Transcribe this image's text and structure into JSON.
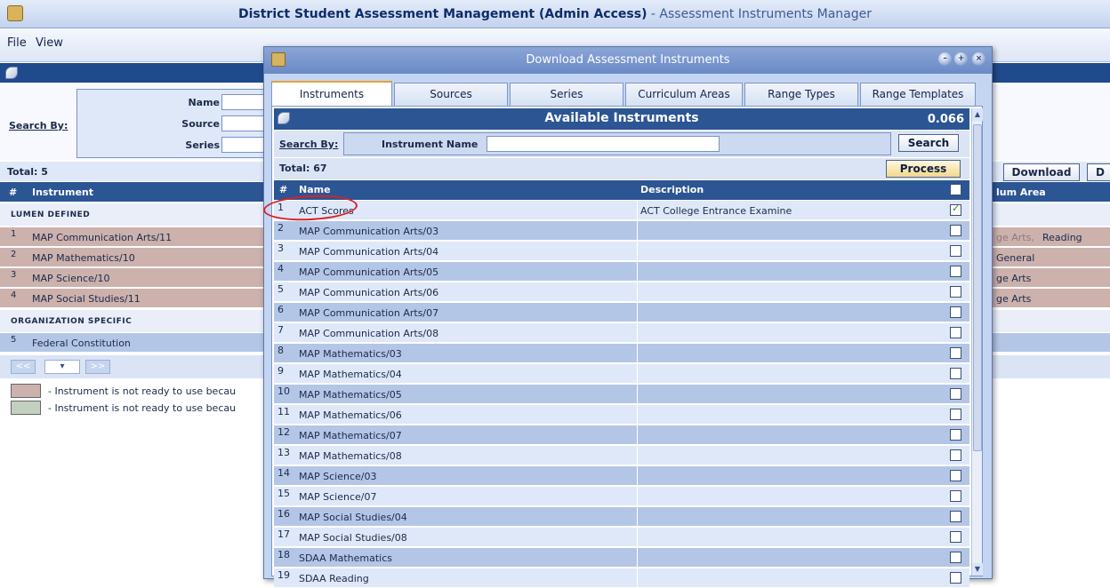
{
  "app": {
    "title_bold": "District Student Assessment Management (Admin Access)",
    "title_sub": " - Assessment Instruments Manager"
  },
  "menu": {
    "file": "File",
    "view": "View"
  },
  "background": {
    "search_by": "Search By:",
    "fields": {
      "name": "Name",
      "source": "Source",
      "series": "Series"
    },
    "total": "Total: 5",
    "col_num": "#",
    "col_instrument": "Instrument",
    "col_area": "lum Area",
    "download_label": "Download",
    "extra_btn_label": "D",
    "group_lumen": "Lumen Defined",
    "group_org": "Organization Specific",
    "rows": [
      {
        "num": "1",
        "name": "MAP Communication Arts/11",
        "area_faded": "ge Arts, ",
        "area": "Reading"
      },
      {
        "num": "2",
        "name": "MAP Mathematics/10",
        "area_faded": "",
        "area": "General"
      },
      {
        "num": "3",
        "name": "MAP Science/10",
        "area_faded": "",
        "area": "ge Arts"
      },
      {
        "num": "4",
        "name": "MAP Social Studies/11",
        "area_faded": "",
        "area": "ge Arts"
      }
    ],
    "org_row": {
      "num": "5",
      "name": "Federal Constitution"
    },
    "pager": {
      "prev": "<<",
      "next": ">>"
    },
    "legend": [
      {
        "color": "#ccb1ad",
        "text": "- Instrument is not ready to use becau"
      },
      {
        "color": "#c3d0c0",
        "text": "- Instrument is not ready to use becau"
      }
    ]
  },
  "dialog": {
    "title": "Download Assessment Instruments",
    "tabs": [
      "Instruments",
      "Sources",
      "Series",
      "Curriculum Areas",
      "Range Types",
      "Range Templates"
    ],
    "header": "Available Instruments",
    "version": "0.066",
    "search_by": "Search By:",
    "instrument_name_label": "Instrument Name",
    "instrument_name_value": "",
    "search_btn": "Search",
    "total": "Total: 67",
    "process_btn": "Process",
    "col_num": "#",
    "col_name": "Name",
    "col_desc": "Description",
    "rows": [
      {
        "num": "1",
        "name": "ACT Scores",
        "desc": "ACT College Entrance Examine",
        "checked": true
      },
      {
        "num": "2",
        "name": "MAP Communication Arts/03",
        "desc": "",
        "checked": false
      },
      {
        "num": "3",
        "name": "MAP Communication Arts/04",
        "desc": "",
        "checked": false
      },
      {
        "num": "4",
        "name": "MAP Communication Arts/05",
        "desc": "",
        "checked": false
      },
      {
        "num": "5",
        "name": "MAP Communication Arts/06",
        "desc": "",
        "checked": false
      },
      {
        "num": "6",
        "name": "MAP Communication Arts/07",
        "desc": "",
        "checked": false
      },
      {
        "num": "7",
        "name": "MAP Communication Arts/08",
        "desc": "",
        "checked": false
      },
      {
        "num": "8",
        "name": "MAP Mathematics/03",
        "desc": "",
        "checked": false
      },
      {
        "num": "9",
        "name": "MAP Mathematics/04",
        "desc": "",
        "checked": false
      },
      {
        "num": "10",
        "name": "MAP Mathematics/05",
        "desc": "",
        "checked": false
      },
      {
        "num": "11",
        "name": "MAP Mathematics/06",
        "desc": "",
        "checked": false
      },
      {
        "num": "12",
        "name": "MAP Mathematics/07",
        "desc": "",
        "checked": false
      },
      {
        "num": "13",
        "name": "MAP Mathematics/08",
        "desc": "",
        "checked": false
      },
      {
        "num": "14",
        "name": "MAP Science/03",
        "desc": "",
        "checked": false
      },
      {
        "num": "15",
        "name": "MAP Science/07",
        "desc": "",
        "checked": false
      },
      {
        "num": "16",
        "name": "MAP Social Studies/04",
        "desc": "",
        "checked": false
      },
      {
        "num": "17",
        "name": "MAP Social Studies/08",
        "desc": "",
        "checked": false
      },
      {
        "num": "18",
        "name": "SDAA Mathematics",
        "desc": "",
        "checked": false
      },
      {
        "num": "19",
        "name": "SDAA Reading",
        "desc": "",
        "checked": false
      }
    ]
  },
  "colors": {
    "header_blue": "#2c5594",
    "annotation_red": "#d92222",
    "row_blue": "#b4c6e6",
    "row_light": "#dfe8f8"
  }
}
